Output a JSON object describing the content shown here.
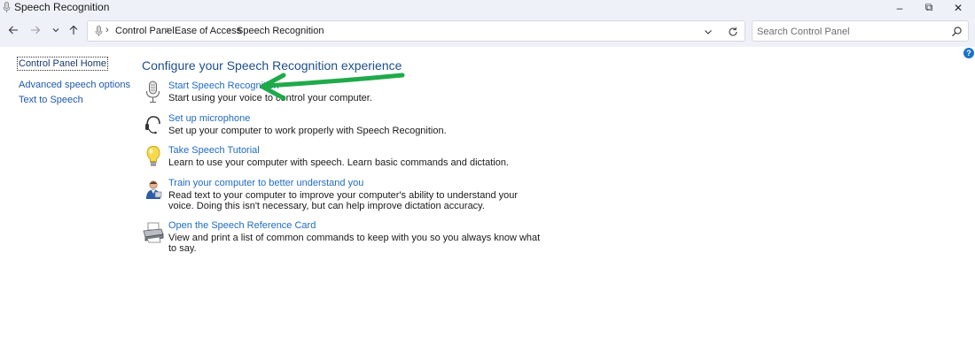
{
  "window": {
    "title": "Speech Recognition",
    "minimize_glyph": "–",
    "maximize_glyph": "⧉",
    "close_glyph": "✕"
  },
  "address": {
    "crumbs": [
      "Control Panel",
      "Ease of Access",
      "Speech Recognition"
    ],
    "separator": "›"
  },
  "search": {
    "placeholder": "Search Control Panel"
  },
  "help": {
    "label": "?"
  },
  "sidebar": {
    "home": "Control Panel Home",
    "links": [
      "Advanced speech options",
      "Text to Speech"
    ]
  },
  "main": {
    "heading": "Configure your Speech Recognition experience",
    "tasks": [
      {
        "icon": "microphone-icon",
        "link": "Start Speech Recognition",
        "description": "Start using your voice to control your computer."
      },
      {
        "icon": "headset-icon",
        "link": "Set up microphone",
        "description": "Set up your computer to work properly with Speech Recognition."
      },
      {
        "icon": "lightbulb-icon",
        "link": "Take Speech Tutorial",
        "description": "Learn to use your computer with speech.  Learn basic commands and dictation."
      },
      {
        "icon": "user-training-icon",
        "link": "Train your computer to better understand you",
        "description": "Read text to your computer to improve your computer's ability to understand your voice.  Doing this isn't necessary, but can help improve dictation accuracy."
      },
      {
        "icon": "printer-icon",
        "link": "Open the Speech Reference Card",
        "description": "View and print a list of common commands to keep with you so you always know what to say."
      }
    ]
  },
  "annotation": {
    "arrow_color": "#1faa4a"
  }
}
